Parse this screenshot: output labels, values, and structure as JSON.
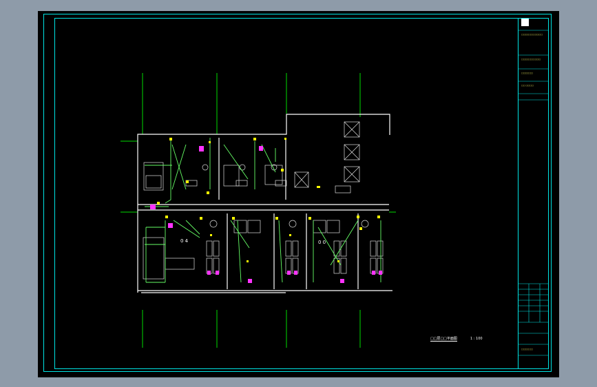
{
  "drawing": {
    "caption": "□□层□□平面图",
    "scale": "1 : 100",
    "room_labels": [
      "0 4",
      "0 0"
    ],
    "tb_lines": [
      "□□□□□□□□□□□",
      "□□□□□□□□□□",
      "□□□□□□",
      "□□ □□□□",
      "□□□□□□"
    ],
    "colors": {
      "background": "#000000",
      "frame": "#00e5e5",
      "wall": "#ffffff",
      "axis": "#00ff00",
      "wiring": "#7dff7d",
      "device": "#ffff00",
      "fixture": "#ff33ff"
    }
  }
}
